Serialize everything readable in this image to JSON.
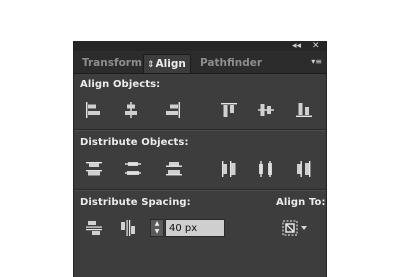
{
  "window": {
    "collapse_glyph": "◂◂",
    "close_glyph": "✕"
  },
  "tabs": [
    {
      "label": "Transform",
      "active": false
    },
    {
      "label": "Align",
      "active": true,
      "caret": "⇕"
    },
    {
      "label": "Pathfinder",
      "active": false
    }
  ],
  "panel_menu_glyph": "▾≡",
  "align_objects": {
    "label": "Align Objects:",
    "icons": [
      "horizontal-align-left-icon",
      "horizontal-align-center-icon",
      "horizontal-align-right-icon",
      "vertical-align-top-icon",
      "vertical-align-center-icon",
      "vertical-align-bottom-icon"
    ]
  },
  "distribute_objects": {
    "label": "Distribute Objects:",
    "icons": [
      "vertical-distribute-top-icon",
      "vertical-distribute-center-icon",
      "vertical-distribute-bottom-icon",
      "horizontal-distribute-left-icon",
      "horizontal-distribute-center-icon",
      "horizontal-distribute-right-icon"
    ]
  },
  "distribute_spacing": {
    "label": "Distribute Spacing:",
    "icons": [
      "vertical-distribute-space-icon",
      "horizontal-distribute-space-icon"
    ],
    "value": "40 px"
  },
  "align_to": {
    "label": "Align To:",
    "icon": "align-to-key-object-icon"
  },
  "colors": {
    "panel_bg": "#3d3d3d",
    "tab_bar_bg": "#2c2c2c",
    "text": "#ececec",
    "input_bg": "#cfcfcf"
  }
}
